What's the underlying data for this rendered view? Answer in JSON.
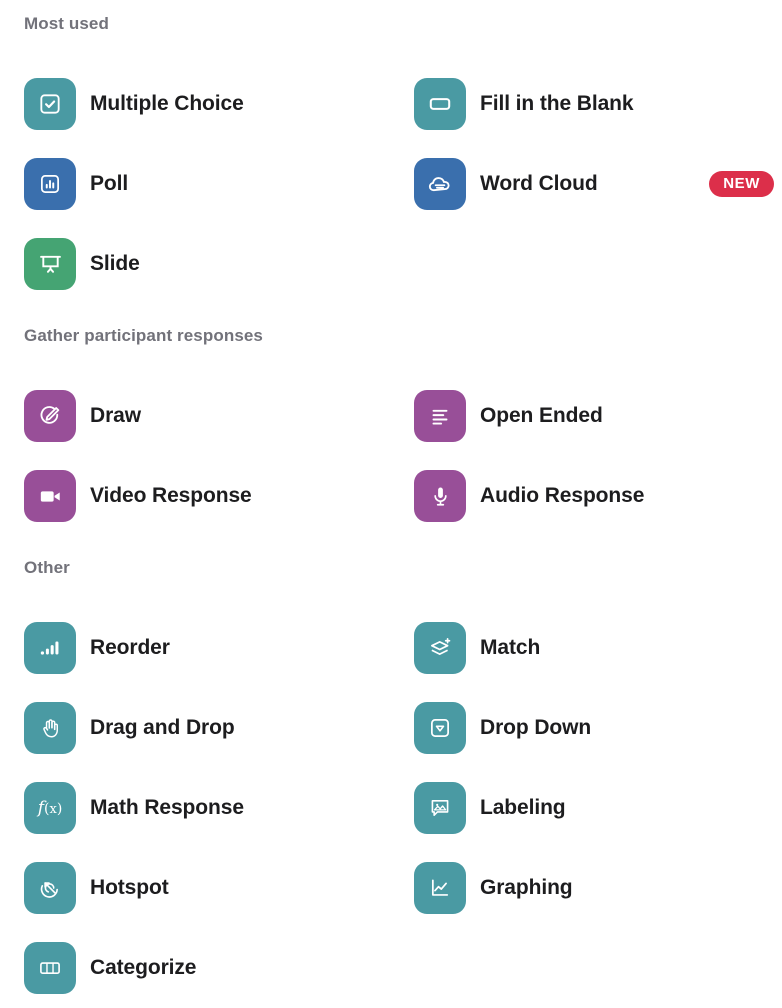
{
  "sections": [
    {
      "id": "most-used",
      "title": "Most used",
      "items": [
        {
          "label": "Multiple Choice",
          "icon": "checkbox-checked-icon",
          "color": "#4a9aa3",
          "badge": null
        },
        {
          "label": "Fill in the Blank",
          "icon": "text-field-icon",
          "color": "#4a9aa3",
          "badge": null
        },
        {
          "label": "Poll",
          "icon": "bar-chart-framed-icon",
          "color": "#3a6fad",
          "badge": null
        },
        {
          "label": "Word Cloud",
          "icon": "cloud-lines-icon",
          "color": "#3a6fad",
          "badge": "NEW"
        },
        {
          "label": "Slide",
          "icon": "projector-screen-icon",
          "color": "#45a473",
          "badge": null
        }
      ]
    },
    {
      "id": "gather-participant-responses",
      "title": "Gather participant responses",
      "items": [
        {
          "label": "Draw",
          "icon": "pencil-circle-icon",
          "color": "#984f98",
          "badge": null
        },
        {
          "label": "Open Ended",
          "icon": "text-lines-icon",
          "color": "#984f98",
          "badge": null
        },
        {
          "label": "Video Response",
          "icon": "video-camera-icon",
          "color": "#984f98",
          "badge": null
        },
        {
          "label": "Audio Response",
          "icon": "microphone-icon",
          "color": "#984f98",
          "badge": null
        }
      ]
    },
    {
      "id": "other",
      "title": "Other",
      "items": [
        {
          "label": "Reorder",
          "icon": "ascending-bars-icon",
          "color": "#4a9aa3",
          "badge": null
        },
        {
          "label": "Match",
          "icon": "layers-plus-icon",
          "color": "#4a9aa3",
          "badge": null
        },
        {
          "label": "Drag and Drop",
          "icon": "hand-icon",
          "color": "#4a9aa3",
          "badge": null
        },
        {
          "label": "Drop Down",
          "icon": "chevron-down-boxed-icon",
          "color": "#4a9aa3",
          "badge": null
        },
        {
          "label": "Math Response",
          "icon": "function-fx-icon",
          "color": "#4a9aa3",
          "badge": null
        },
        {
          "label": "Labeling",
          "icon": "image-callout-icon",
          "color": "#4a9aa3",
          "badge": null
        },
        {
          "label": "Hotspot",
          "icon": "target-arrow-icon",
          "color": "#4a9aa3",
          "badge": null
        },
        {
          "label": "Graphing",
          "icon": "line-graph-icon",
          "color": "#4a9aa3",
          "badge": null
        },
        {
          "label": "Categorize",
          "icon": "columns-icon",
          "color": "#4a9aa3",
          "badge": null
        }
      ]
    }
  ],
  "colors": {
    "teal": "#4a9aa3",
    "blue": "#3a6fad",
    "green": "#45a473",
    "purple": "#984f98",
    "badge_red": "#dc2f4a",
    "header_gray": "#72727a",
    "label_black": "#1d1d1f"
  }
}
